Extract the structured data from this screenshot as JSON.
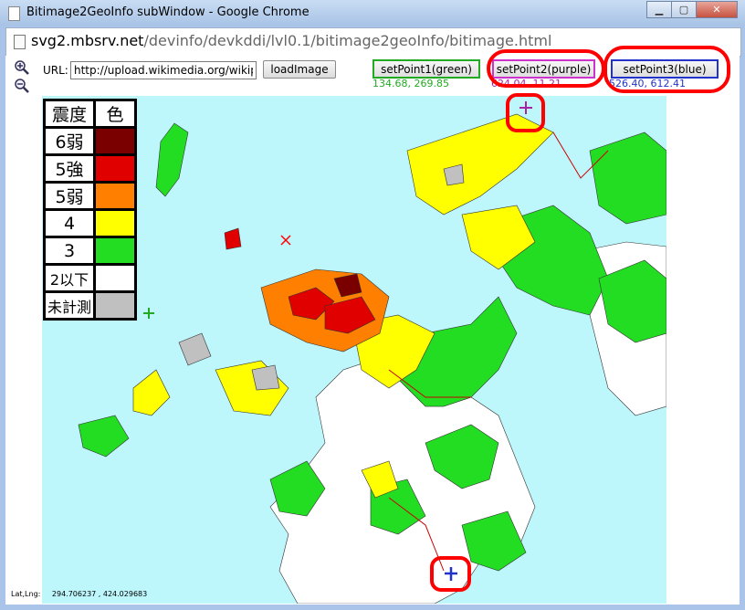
{
  "window": {
    "title": "Bitimage2GeoInfo subWindow - Google Chrome"
  },
  "address": {
    "domain": "svg2.mbsrv.net",
    "path": "/devinfo/devkddi/lvl0.1/bitimage2geoInfo/bitimage.html"
  },
  "toolbar": {
    "url_label": "URL:",
    "url_value": "http://upload.wikimedia.org/wikipedia/",
    "load_label": "loadImage"
  },
  "points": [
    {
      "label": "setPoint1(green)",
      "coords": "134.68, 269.85",
      "color": "#22aa22"
    },
    {
      "label": "setPoint2(purple)",
      "coords": "624.04, 11.21",
      "color": "#aa22aa"
    },
    {
      "label": "setPoint3(blue)",
      "coords": "526.40, 612.41",
      "color": "#2233cc"
    }
  ],
  "legend": {
    "header": [
      "震度",
      "色"
    ],
    "rows": [
      {
        "label": "6弱",
        "color": "#7a0000"
      },
      {
        "label": "5強",
        "color": "#e00000"
      },
      {
        "label": "5弱",
        "color": "#ff8000"
      },
      {
        "label": "4",
        "color": "#ffff00"
      },
      {
        "label": "3",
        "color": "#22dd22"
      },
      {
        "label": "2以下",
        "color": "#ffffff"
      },
      {
        "label": "未計測",
        "color": "#c0c0c0"
      }
    ]
  },
  "status": {
    "label": "Lat,Lng:",
    "value": "294.706237 , 424.029683"
  },
  "colors": {
    "sea": "#bdf6fb",
    "border_line": "#3333ff",
    "highlight": "#ff0000"
  }
}
